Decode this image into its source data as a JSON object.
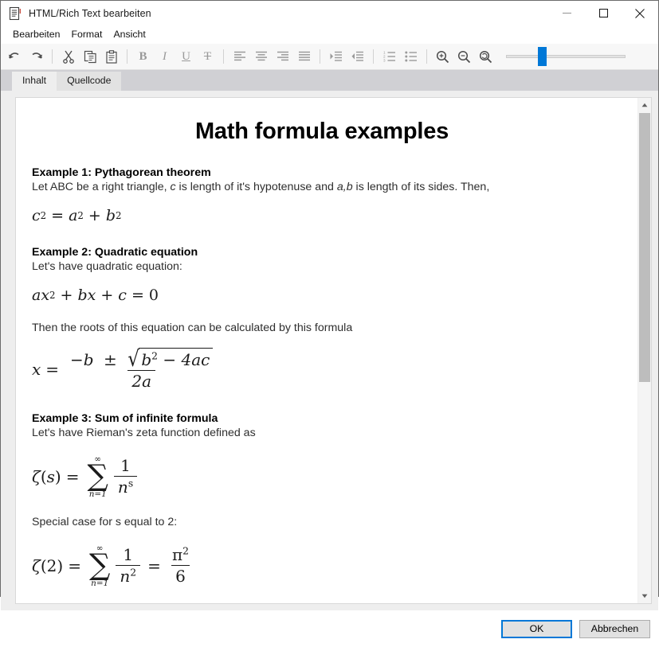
{
  "window": {
    "title": "HTML/Rich Text bearbeiten",
    "icon": "document-icon",
    "minimize_label": "—",
    "maximize_label": "□",
    "close_label": "✕"
  },
  "menubar": {
    "items": [
      {
        "label": "Bearbeiten",
        "name": "menu-bearbeiten"
      },
      {
        "label": "Format",
        "name": "menu-format"
      },
      {
        "label": "Ansicht",
        "name": "menu-ansicht"
      }
    ]
  },
  "toolbar": {
    "groups": [
      {
        "buttons": [
          {
            "name": "undo-icon",
            "title": "Undo"
          },
          {
            "name": "redo-icon",
            "title": "Redo"
          }
        ]
      },
      {
        "buttons": [
          {
            "name": "cut-icon",
            "title": "Cut"
          },
          {
            "name": "copy-icon",
            "title": "Copy"
          },
          {
            "name": "paste-icon",
            "title": "Paste"
          }
        ]
      },
      {
        "buttons": [
          {
            "name": "bold-icon",
            "title": "Bold",
            "glyph": "B"
          },
          {
            "name": "italic-icon",
            "title": "Italic",
            "glyph": "I"
          },
          {
            "name": "underline-icon",
            "title": "Underline",
            "glyph": "U"
          },
          {
            "name": "strikethrough-icon",
            "title": "Strikethrough",
            "glyph": "T"
          }
        ]
      },
      {
        "buttons": [
          {
            "name": "align-left-icon",
            "title": "Align left"
          },
          {
            "name": "align-center-icon",
            "title": "Align center"
          },
          {
            "name": "align-right-icon",
            "title": "Align right"
          },
          {
            "name": "align-justify-icon",
            "title": "Justify"
          }
        ]
      },
      {
        "buttons": [
          {
            "name": "indent-increase-icon",
            "title": "Increase indent"
          },
          {
            "name": "indent-decrease-icon",
            "title": "Decrease indent"
          }
        ]
      },
      {
        "buttons": [
          {
            "name": "numbered-list-icon",
            "title": "Numbered list"
          },
          {
            "name": "bulleted-list-icon",
            "title": "Bulleted list"
          }
        ]
      },
      {
        "buttons": [
          {
            "name": "zoom-in-icon",
            "title": "Zoom in"
          },
          {
            "name": "zoom-out-icon",
            "title": "Zoom out"
          },
          {
            "name": "zoom-reset-icon",
            "title": "Reset zoom"
          }
        ]
      }
    ],
    "zoom_slider": {
      "name": "zoom-slider",
      "thumb_position_percent": 28,
      "accent_color": "#0078d7"
    }
  },
  "tabs": {
    "items": [
      {
        "label": "Inhalt",
        "name": "tab-inhalt",
        "active": true
      },
      {
        "label": "Quellcode",
        "name": "tab-quellcode",
        "active": false
      }
    ]
  },
  "document": {
    "title": "Math formula examples",
    "sections": [
      {
        "heading": "Example 1: Pythagorean theorem",
        "intro_a": "Let ABC be a right triangle, ",
        "intro_var1": "c",
        "intro_b": " is length of it's hypotenuse and ",
        "intro_var2": "a,b",
        "intro_c": " is length of its sides. Then,"
      },
      {
        "heading": "Example 2: Quadratic equation",
        "intro": "Let's have quadratic equation:",
        "intro2": "Then the roots of this equation can be calculated by this formula"
      },
      {
        "heading": "Example 3: Sum of infinite formula",
        "intro": "Let's have Rieman's zeta function defined as",
        "intro2": "Special case for s equal to 2:"
      }
    ],
    "formulas": {
      "pythagorean": {
        "c": "c",
        "c_exp": "2",
        "eq": "=",
        "a": "a",
        "a_exp": "2",
        "plus": "+",
        "b": "b",
        "b_exp": "2"
      },
      "quadratic_eq": {
        "a": "a",
        "x": "x",
        "x_exp": "2",
        "plus1": "+",
        "b": "b",
        "x2": "x",
        "plus2": "+",
        "c": "c",
        "eq": "=",
        "zero": "0"
      },
      "quadratic_roots": {
        "x": "x",
        "eq": "=",
        "minus_b": "−b",
        "pm": "±",
        "radical": "√",
        "b": "b",
        "b_exp": "2",
        "minus": "−",
        "four_ac": "4ac",
        "den": "2a"
      },
      "zeta_s": {
        "zeta": "ζ",
        "open": "(",
        "s": "s",
        "close": ")",
        "eq": "=",
        "sigma": "∑",
        "upper": "∞",
        "lower": "n=1",
        "num": "1",
        "den_n": "n",
        "den_exp": "s"
      },
      "zeta_2": {
        "zeta": "ζ",
        "open": "(",
        "two": "2",
        "close": ")",
        "eq": "=",
        "sigma": "∑",
        "upper": "∞",
        "lower": "n=1",
        "num": "1",
        "den_n": "n",
        "den_exp": "2",
        "eq2": "=",
        "pi": "π",
        "pi_exp": "2",
        "six": "6"
      }
    }
  },
  "scrollbar": {
    "up_arrow": "▲",
    "down_arrow": "▼",
    "thumb_top_percent": 3,
    "thumb_height_percent": 58
  },
  "footer": {
    "ok_label": "OK",
    "cancel_label": "Abbrechen",
    "accent_color": "#0078d7"
  }
}
